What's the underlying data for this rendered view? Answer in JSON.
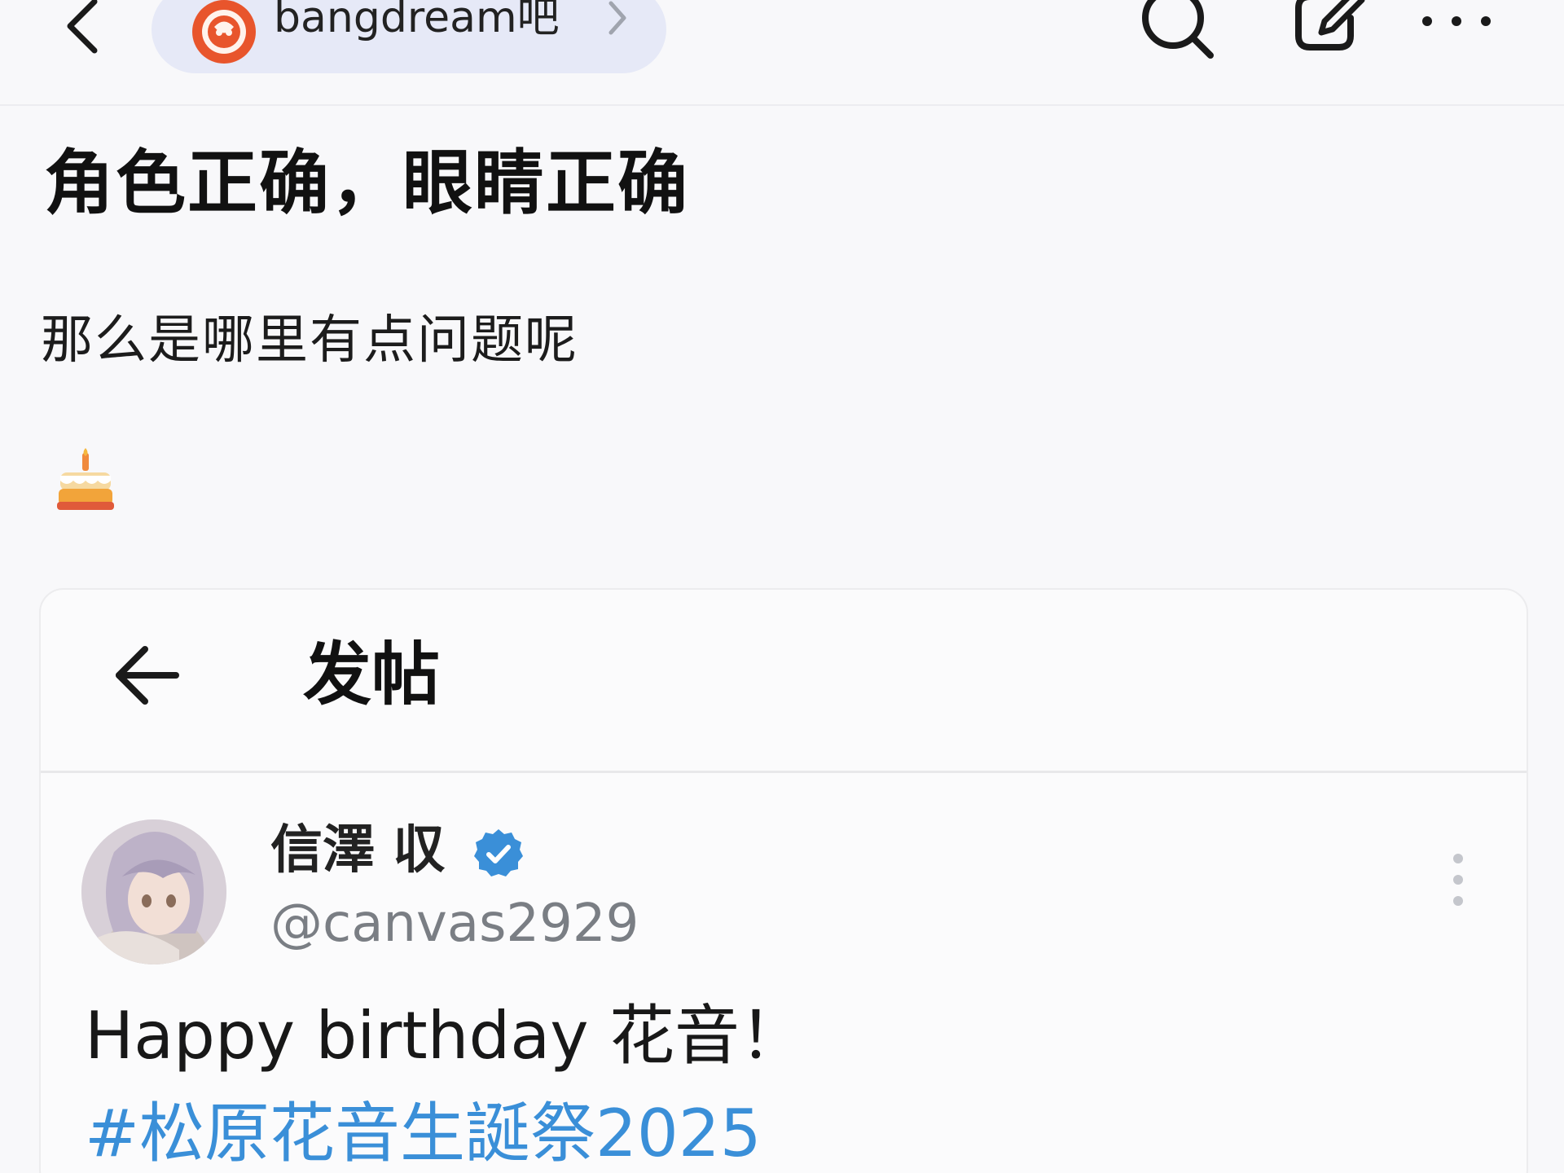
{
  "header": {
    "forum_name": "bangdream吧",
    "icons": [
      "back-icon",
      "search-icon",
      "compose-icon",
      "more-icon"
    ]
  },
  "post": {
    "title": "角色正确，眼睛正确",
    "body": "那么是哪里有点问题呢",
    "emoji": "cake-icon"
  },
  "embedded_screenshot": {
    "header_title": "发帖",
    "author": {
      "name": "信澤 収",
      "handle": "@canvas2929",
      "verified": true
    },
    "tweet_text": "Happy birthday 花音！",
    "hashtag": "#松原花音生誕祭2025"
  },
  "colors": {
    "background": "#f8f8fa",
    "forum_pill": "#e6e9f7",
    "forum_logo": "#e8552c",
    "hashtag": "#3a8fd8",
    "verified_badge": "#3a8fd8"
  }
}
